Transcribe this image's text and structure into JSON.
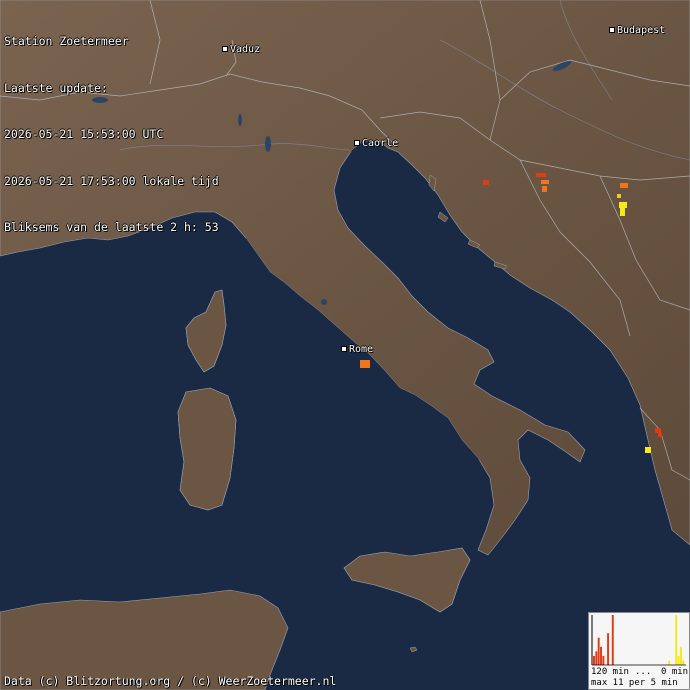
{
  "header": {
    "station": "Station Zoetermeer",
    "update_label": "Laatste update:",
    "utc_time": "2026-05-21 15:53:00 UTC",
    "local_time": "2026-05-21 17:53:00 lokale tijd",
    "strikes": "Bliksems van de laatste 2 h: 53"
  },
  "credit": "Data (c) Blitzortung.org / (c) WeerZoetermeer.nl",
  "cities": [
    {
      "name": "Budapest",
      "id": "budapest"
    },
    {
      "name": "Vaduz",
      "id": "vaduz"
    },
    {
      "name": "Caorle",
      "id": "caorle"
    },
    {
      "name": "Rome",
      "id": "rome"
    }
  ],
  "legend": {
    "left_label": "120 min",
    "mid_label": "...",
    "right_label": "0 min",
    "bottom_label": "max 11 per 5 min",
    "bins": [
      2,
      3,
      6,
      4,
      2,
      0,
      7,
      0,
      11,
      0,
      0,
      0,
      0,
      0,
      0,
      0,
      0,
      0,
      0,
      0,
      0,
      0,
      0,
      0,
      0,
      0,
      0,
      0,
      0,
      0,
      0,
      0,
      1,
      0,
      0,
      11,
      2,
      4,
      1,
      0
    ],
    "max": 11
  },
  "colors": {
    "sea": "#1b2a44",
    "land": "#6e5a48",
    "strike_old": "#e23a14",
    "strike_mid": "#f0761e",
    "strike_new": "#f8e81a"
  }
}
